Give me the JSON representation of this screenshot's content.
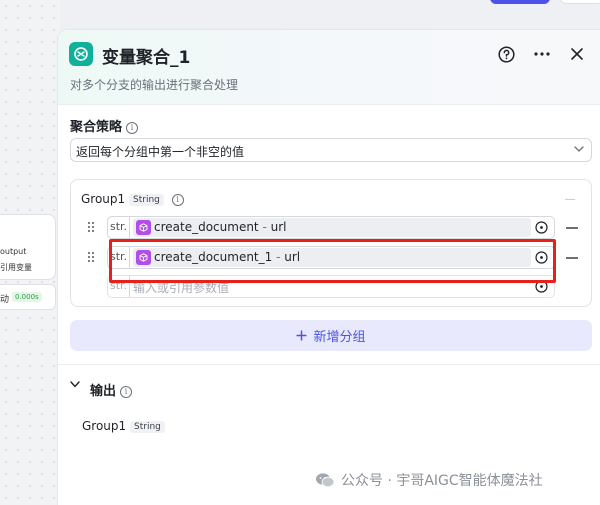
{
  "canvas": {
    "node_output": "output",
    "node_var": "引用变量",
    "node_status": "动",
    "node_time": "0.000s"
  },
  "panel": {
    "title": "变量聚合_1",
    "description": "对多个分支的输出进行聚合处理",
    "icons": {
      "help": "help-circle-icon",
      "more": "more-dots-icon",
      "close": "close-icon"
    }
  },
  "strategy": {
    "label": "聚合策略",
    "selected": "返回每个分组中第一个非空的值"
  },
  "group": {
    "name": "Group1",
    "type": "String",
    "rows": [
      {
        "type": "str.",
        "node": "create_document",
        "sep": " - ",
        "field": "url"
      },
      {
        "type": "str.",
        "node": "create_document_1",
        "sep": " - ",
        "field": "url"
      }
    ],
    "new_row": {
      "type": "str.",
      "placeholder": "输入或引用参数值"
    }
  },
  "add_group_label": "新增分组",
  "output": {
    "label": "输出",
    "name": "Group1",
    "type": "String"
  },
  "watermark": "公众号 · 宇哥AIGC智能体魔法社",
  "colors": {
    "accent": "#4d53e8",
    "node_icon": "#10b09a",
    "highlight": "#e8201a"
  }
}
